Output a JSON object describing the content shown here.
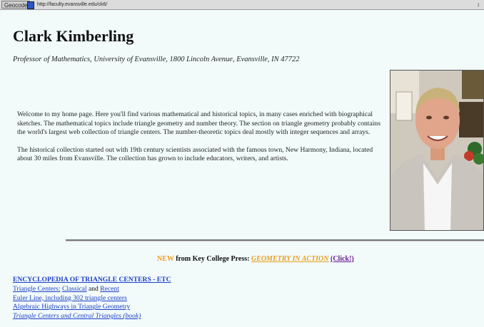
{
  "browser": {
    "bookmark_button": "Geocode",
    "url": "http://faculty.evansville.edu/ck6/"
  },
  "header": {
    "title": "Clark Kimberling",
    "subtitle": "Professor of Mathematics, University of Evansville, 1800 Lincoln Avenue, Evansville, IN 47722"
  },
  "intro": {
    "paragraphs": [
      "Welcome to my home page. Here you'll find various mathematical and historical topics, in many cases enriched with biographical sketches. The mathematical topics include triangle geometry and number theory. The section on triangle geometry probably contains the world's largest web collection of triangle centers. The number-theoretic topics deal mostly with integer sequences and arrays.",
      "The historical collection started out with 19th century scientists associated with the famous town, New Harmony, Indiana, located about 30 miles from Evansville. The collection has grown to include educators, writers, and artists."
    ]
  },
  "promo": {
    "new_label": "NEW",
    "text": "from Key College Press:",
    "book_title": "GEOMETRY IN ACTION",
    "click_label": "(Click!)"
  },
  "links": {
    "etc_title": "ENCYCLOPEDIA OF TRIANGLE CENTERS - ETC",
    "triangle_centers_prefix": "Triangle Centers:",
    "classical": "Classical",
    "and": "and",
    "recent": "Recent",
    "euler_line": "Euler Line, including 302 triangle centers",
    "algebraic_highways": "Algebraic Highways in Triangle Geometry",
    "triangle_centers_book": "Triangle Centers and Central Triangles (book)"
  },
  "colors": {
    "background": "#f2fafa",
    "link": "#1a3fc7",
    "new_accent": "#f0a020",
    "click_link": "#6a1b9a"
  }
}
